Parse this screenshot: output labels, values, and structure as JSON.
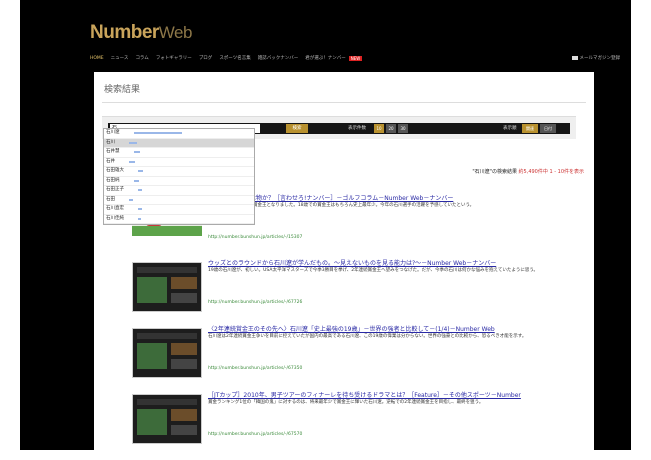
{
  "brand": {
    "name": "Number",
    "suffix": "Web"
  },
  "nav": {
    "items": [
      "HOME",
      "ニュース",
      "コラム",
      "フォトギャラリー",
      "ブログ",
      "スポーツ名言集",
      "雑誌バックナンバー",
      "君が選ぶ！ナンバー"
    ],
    "new_badge": "NEW",
    "mail_label": "メールマガジン登録"
  },
  "page_title": "検索結果",
  "search": {
    "input_value": "石",
    "button_label": "検索",
    "per_page_label": "表示件数",
    "per_page_options": [
      "10",
      "20",
      "30"
    ],
    "sort_label": "表示順",
    "sort_options": [
      "関連",
      "日付"
    ]
  },
  "suggestions": [
    "石川遼",
    "石川",
    "石井慧",
    "石井",
    "石田雄大",
    "石田純",
    "石田正子",
    "石田",
    "石川直宏",
    "石川佳純"
  ],
  "summary": {
    "query": "\"石川遼\"",
    "prefix": "の検索結果",
    "count": "約5,490件中",
    "range": "1 - 10件を表示"
  },
  "results": [
    {
      "title": "石川遼の強さは本物か？［言わせろ!ナンバー］－ゴルフコラム－Number Web－ナンバー",
      "desc": "ルファー石川遼選手の賞金王となりました。18歳での賞金王はもちろん史上最年少。今年の石川選手の活躍を予感していたという。",
      "url": "http://number.bunshun.jp/articles/-/15307"
    },
    {
      "title": "ウッズとのラウンドから石川遼が学んだもの。～見えないものを見る能力は?～－Number Web－ナンバー",
      "desc": "19歳の石川遼が、初しい。USA太平洋マスターズで今季3勝目を挙げ、2年連続賞金王へ望みをつなげた。だが、今季の石川は何かな悩みを抱えていたように思う。",
      "url": "http://number.bunshun.jp/articles/-/67726"
    },
    {
      "title": "〈2年連続賞金王のその先へ〉石川遼「史上最強の19歳」－世界の強者と比較して－(1/4)－Number Web",
      "desc": "石川遼は2年連続賞金王争いを目前に控えていたが国内の最高である石川遼、この19歳の偉業は分からない。世界の強豪との比較から、恐るべき才能を示す。",
      "url": "http://number.bunshun.jp/articles/-/67350"
    },
    {
      "title": "［JTカップ］2010年、男子ツアーのフィナーレを待ち受けるドラマとは？［Feature］－その他スポーツ－Number",
      "desc": "賞金ランキング1位の「韓国の鬼」に対するのは、将来最年少で賞金王に輝いた石川遼。逆転での2年連続賞金王を目指し、最終を狙う。",
      "url": "http://number.bunshun.jp/articles/-/67570"
    }
  ]
}
